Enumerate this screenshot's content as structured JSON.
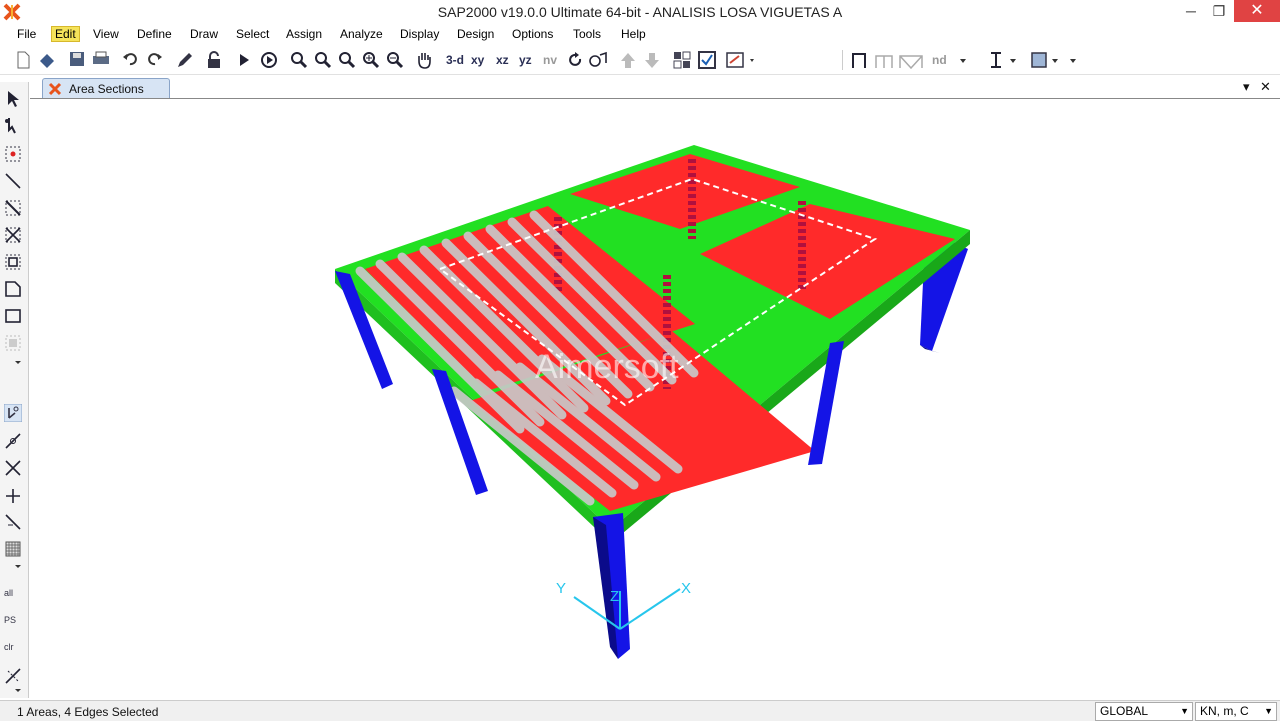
{
  "window": {
    "title": "SAP2000 v19.0.0 Ultimate 64-bit - ANALISIS LOSA VIGUETAS A",
    "minimize": "─",
    "maximize": "❐",
    "close": "✕"
  },
  "menu": [
    {
      "label": "File"
    },
    {
      "label": "Edit"
    },
    {
      "label": "View"
    },
    {
      "label": "Define"
    },
    {
      "label": "Draw"
    },
    {
      "label": "Select"
    },
    {
      "label": "Assign"
    },
    {
      "label": "Analyze"
    },
    {
      "label": "Display"
    },
    {
      "label": "Design"
    },
    {
      "label": "Options"
    },
    {
      "label": "Tools"
    },
    {
      "label": "Help"
    }
  ],
  "toolbar": {
    "view_3d": "3-d",
    "view_xy": "xy",
    "view_xz": "xz",
    "view_yz": "yz",
    "view_nv": "nv",
    "nd": "nd"
  },
  "tab": {
    "label": "Area Sections",
    "dropdown": "▾",
    "close": "✕"
  },
  "viewport": {
    "watermark": "Aimersoft",
    "axes": {
      "x": "X",
      "y": "Y",
      "z": "Z"
    },
    "colors": {
      "slab": "#ff2a2a",
      "beam": "#22e022",
      "column": "#1414e6",
      "joist": "#c8c8c8"
    }
  },
  "lefttools": {
    "all": "all",
    "ps": "PS",
    "clr": "clr"
  },
  "status": {
    "text": "1 Areas, 4 Edges Selected",
    "coord_system": "GLOBAL",
    "units": "KN, m, C"
  }
}
